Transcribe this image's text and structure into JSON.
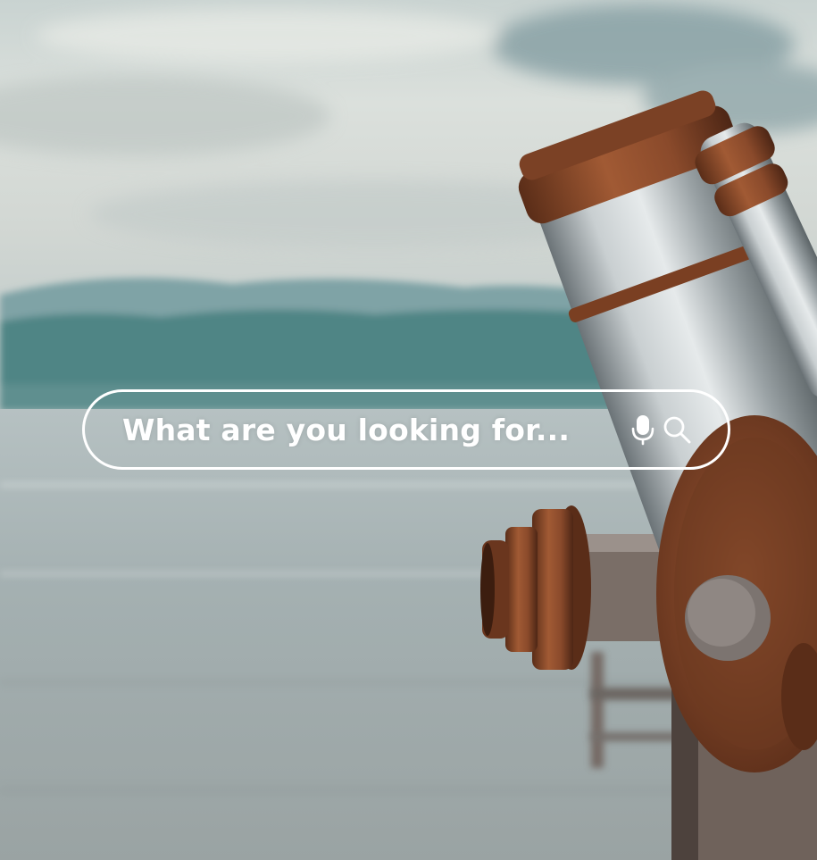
{
  "search": {
    "placeholder": "What are you looking for...",
    "mic_icon": "microphone-icon",
    "search_icon": "magnifier-icon"
  },
  "colors": {
    "sky": "#d6dcd9",
    "mountains": "#4e8585",
    "water": "#a9b4b4",
    "copper": "#8a4a2b",
    "steel": "#b8c0c2",
    "bar_stroke": "#ffffff",
    "text": "#ffffff"
  }
}
